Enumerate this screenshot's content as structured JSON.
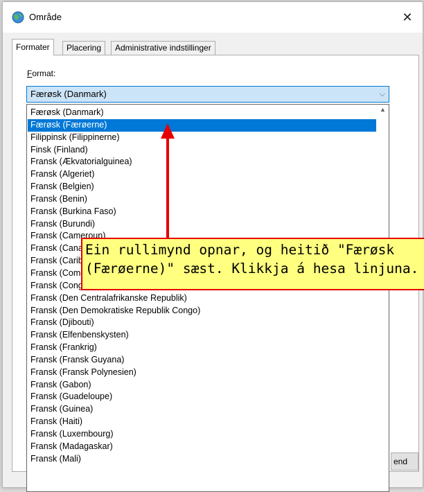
{
  "window": {
    "title": "Område",
    "close_glyph": "✕"
  },
  "tabs": [
    {
      "label": "Formater",
      "active": true
    },
    {
      "label": "Placering",
      "active": false
    },
    {
      "label": "Administrative indstillinger",
      "active": false
    }
  ],
  "format": {
    "label_first": "F",
    "label_rest": "ormat:",
    "selected_value": "Færøsk (Danmark)",
    "chevron": "⌵"
  },
  "dropdown": {
    "scroll_up_glyph": "▲",
    "options": [
      "Færøsk (Danmark)",
      "Færøsk (Færøerne)",
      "Filippinsk (Filippinerne)",
      "Finsk (Finland)",
      "Fransk (Ækvatorialguinea)",
      "Fransk (Algeriet)",
      "Fransk (Belgien)",
      "Fransk (Benin)",
      "Fransk (Burkina Faso)",
      "Fransk (Burundi)",
      "Fransk (Cameroun)",
      "Fransk (Canada)",
      "Fransk (Caribien)",
      "Fransk (Comorerne)",
      "Fransk (Congo)",
      "Fransk (Den Centralafrikanske Republik)",
      "Fransk (Den Demokratiske Republik Congo)",
      "Fransk (Djibouti)",
      "Fransk (Elfenbenskysten)",
      "Fransk (Frankrig)",
      "Fransk (Fransk Guyana)",
      "Fransk (Fransk Polynesien)",
      "Fransk (Gabon)",
      "Fransk (Guadeloupe)",
      "Fransk (Guinea)",
      "Fransk (Haiti)",
      "Fransk (Luxembourg)",
      "Fransk (Madagaskar)",
      "Fransk (Mali)"
    ],
    "highlighted_index": 1
  },
  "partial_button": {
    "label": "end"
  },
  "annotation": {
    "text": "Ein rullimynd opnar, og heitið \"Færøsk\n(Færøerne)\" sæst. Klikkja á hesa linjuna.",
    "border_color": "#e60000",
    "fill_color": "#ffff80"
  }
}
